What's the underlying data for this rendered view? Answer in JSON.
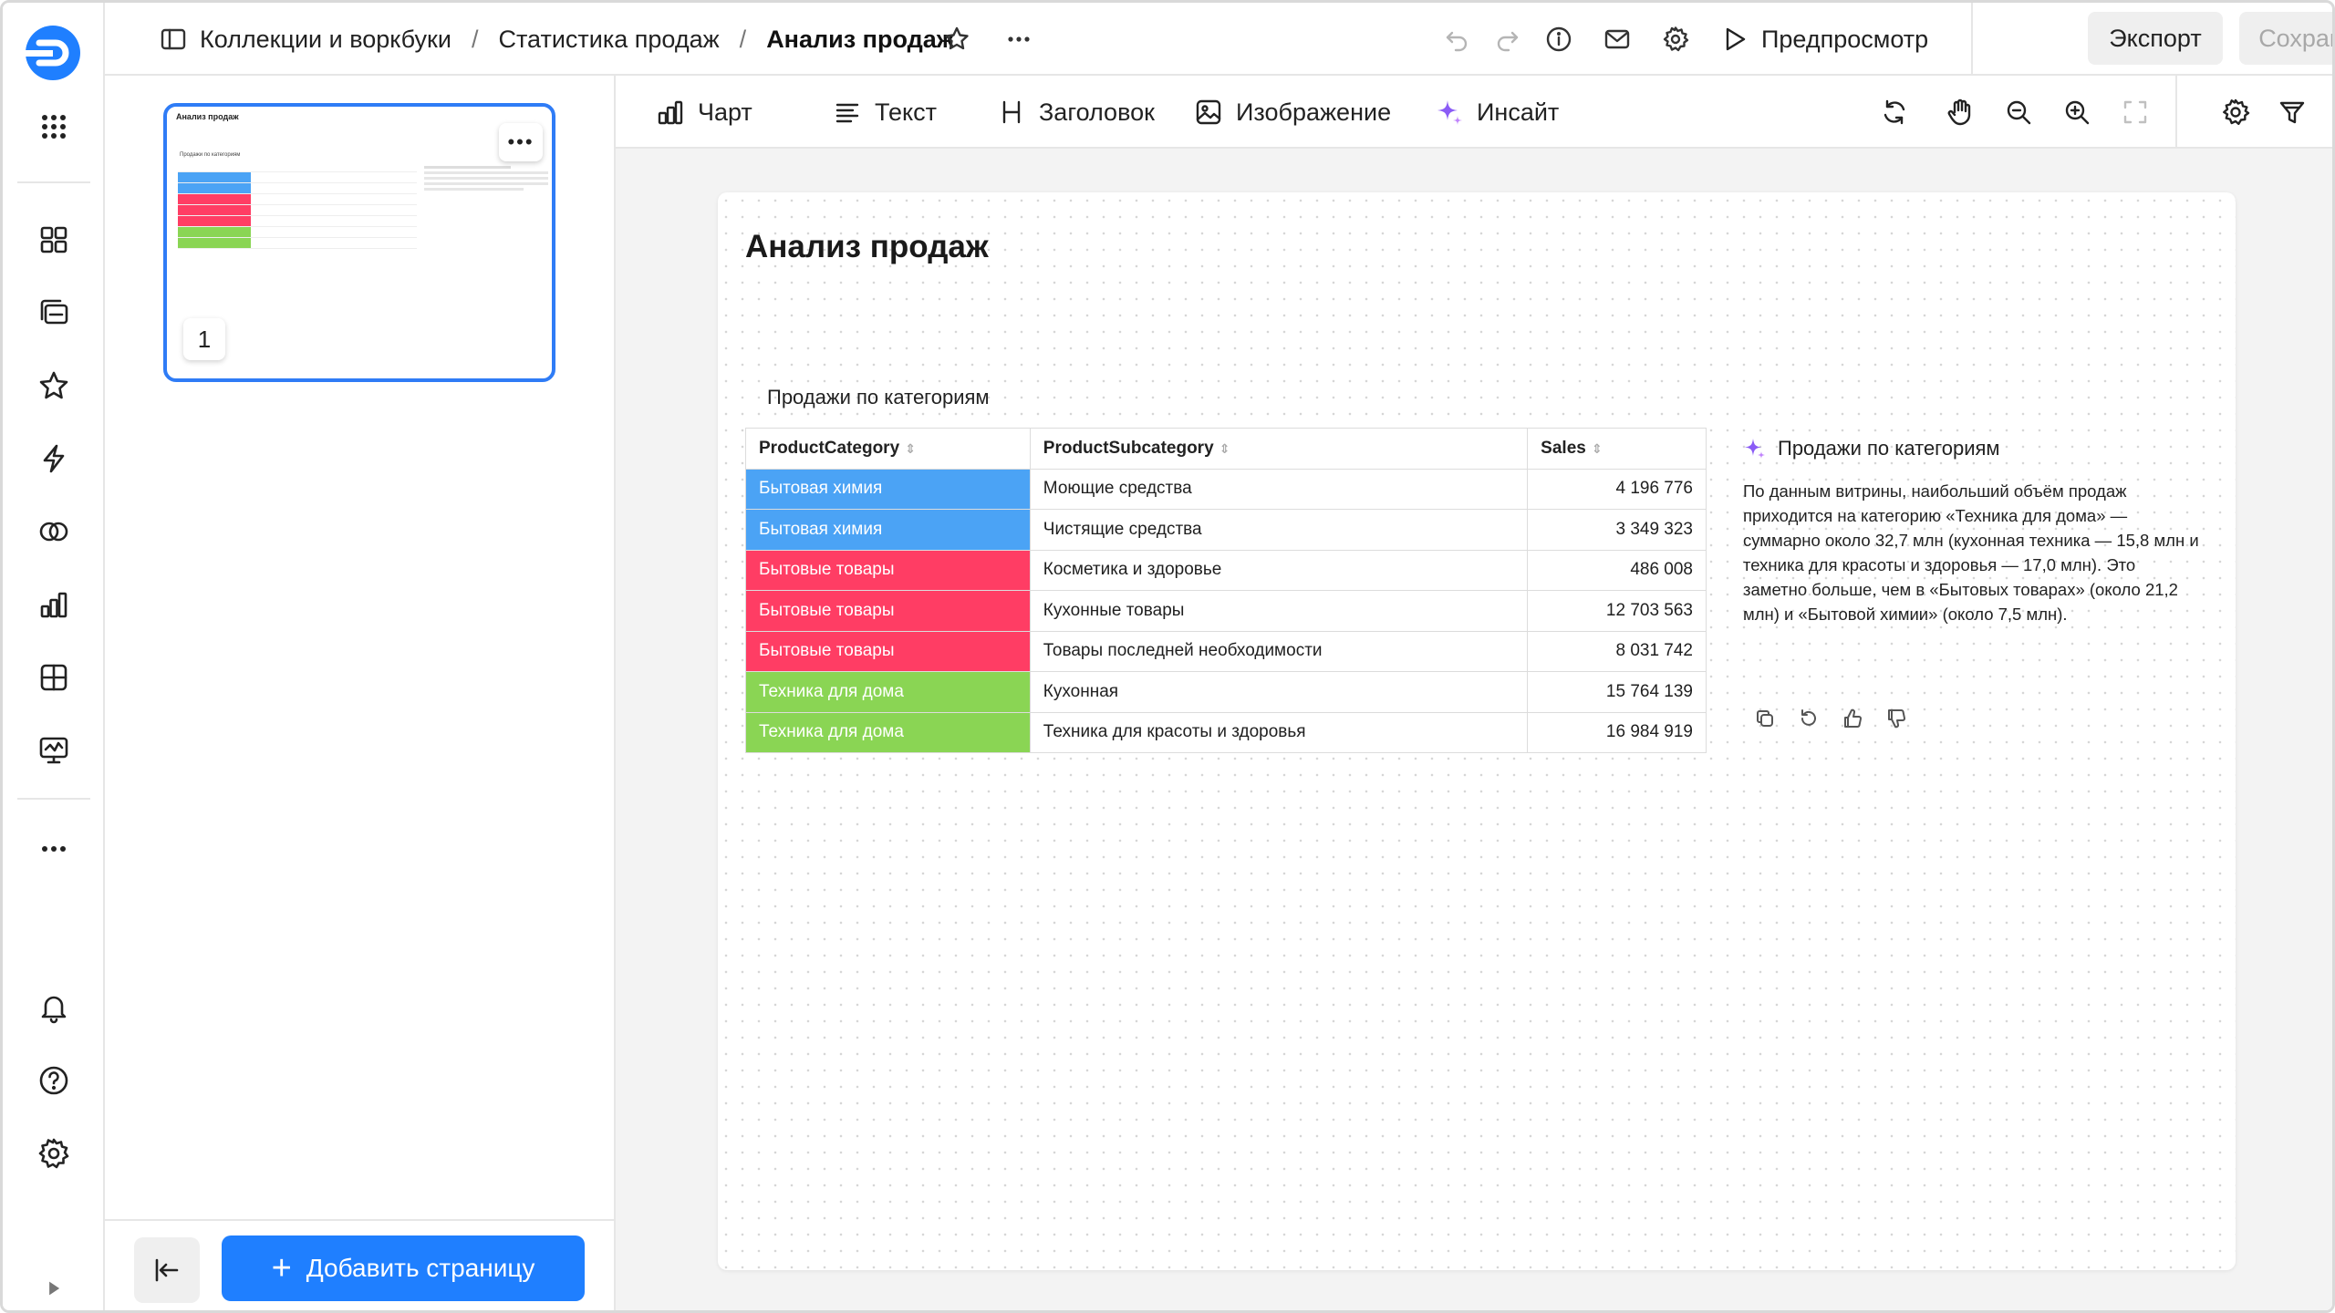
{
  "breadcrumbs": {
    "collections": "Коллекции и воркбуки",
    "workbook": "Статистика продаж",
    "current": "Анализ продаж"
  },
  "header": {
    "preview_label": "Предпросмотр",
    "export_label": "Экспорт",
    "saved_label": "Сохранено"
  },
  "toolbar": {
    "chart_label": "Чарт",
    "text_label": "Текст",
    "heading_label": "Заголовок",
    "image_label": "Изображение",
    "insight_label": "Инсайт"
  },
  "pages_panel": {
    "page_number": "1",
    "add_page_label": "Добавить страницу"
  },
  "sheet": {
    "title": "Анализ продаж",
    "table_title": "Продажи по категориям",
    "columns": [
      "ProductCategory",
      "ProductSubcategory",
      "Sales"
    ],
    "rows": [
      {
        "category": "Бытовая химия",
        "subcategory": "Моющие средства",
        "sales": "4 196 776",
        "color": "#4ba3f5"
      },
      {
        "category": "Бытовая химия",
        "subcategory": "Чистящие средства",
        "sales": "3 349 323",
        "color": "#4ba3f5"
      },
      {
        "category": "Бытовые товары",
        "subcategory": "Косметика и здоровье",
        "sales": "486 008",
        "color": "#ff3d64"
      },
      {
        "category": "Бытовые товары",
        "subcategory": "Кухонные товары",
        "sales": "12 703 563",
        "color": "#ff3d64"
      },
      {
        "category": "Бытовые товары",
        "subcategory": "Товары последней необходимости",
        "sales": "8 031 742",
        "color": "#ff3d64"
      },
      {
        "category": "Техника для дома",
        "subcategory": "Кухонная",
        "sales": "15 764 139",
        "color": "#8ad554"
      },
      {
        "category": "Техника для дома",
        "subcategory": "Техника для красоты и здоровья",
        "sales": "16 984 919",
        "color": "#8ad554"
      }
    ],
    "insight": {
      "title": "Продажи по категориям",
      "text": "По данным витрины, наибольший объём продаж приходится на категорию «Техника для дома» — суммарно около 32,7 млн (кухонная техника — 15,8 млн и техника для красоты и здоровья — 17,0 млн). Это заметно больше, чем в «Бытовых товарах» (около 21,2 млн) и «Бытовой химии» (около 7,5 млн)."
    }
  },
  "colors": {
    "accent": "#1f7fff",
    "insight_sparkle": "#8b5cf6"
  }
}
